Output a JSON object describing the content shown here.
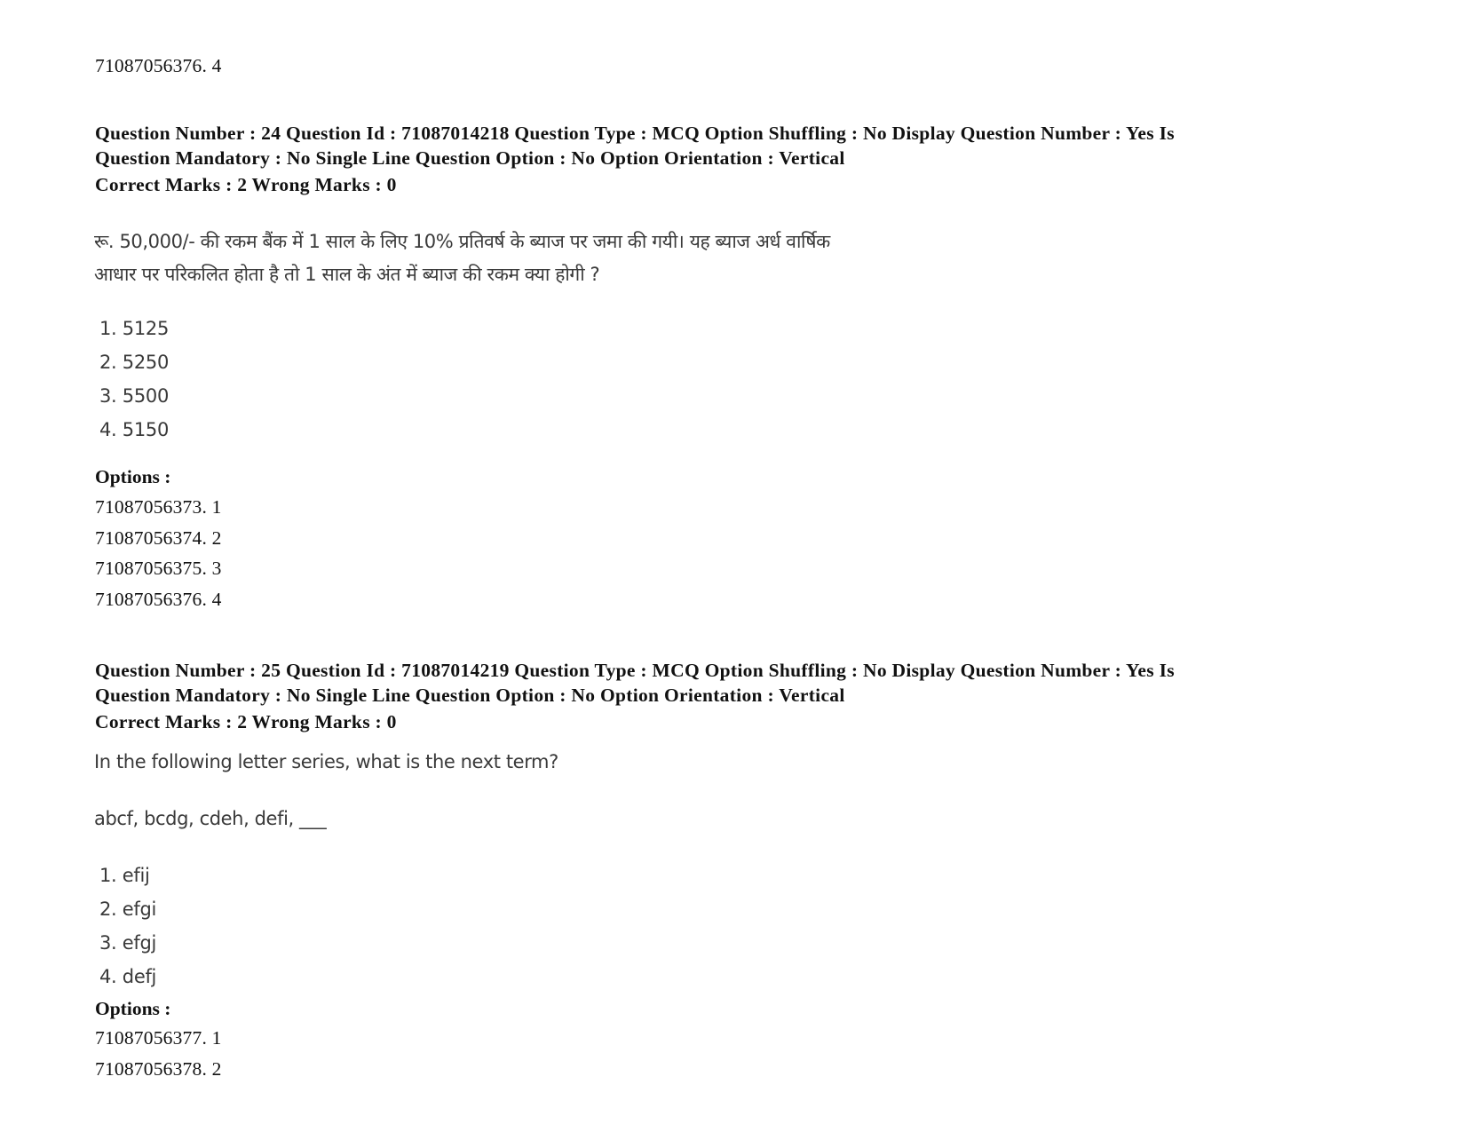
{
  "previous_tail": {
    "option_id_row": "71087056376. 4"
  },
  "questions": [
    {
      "meta_line1": "Question Number : 24 Question Id : 71087014218 Question Type : MCQ Option Shuffling : No Display Question Number : Yes Is",
      "meta_line2": "Question Mandatory : No Single Line Question Option : No Option Orientation : Vertical",
      "marks": "Correct Marks : 2 Wrong Marks : 0",
      "text_lines": [
        "रू. 50,000/- की रकम बैंक में 1 साल के लिए 10% प्रतिवर्ष के ब्याज पर जमा की गयी। यह ब्याज अर्ध वार्षिक",
        "आधार पर परिकलित होता है तो 1 साल के अंत में ब्याज की रकम क्या होगी ?"
      ],
      "choices": [
        "1. 5125",
        "2. 5250",
        "3. 5500",
        "4. 5150"
      ],
      "options_label": "Options :",
      "option_ids": [
        "71087056373. 1",
        "71087056374. 2",
        "71087056375. 3",
        "71087056376. 4"
      ]
    },
    {
      "meta_line1": "Question Number : 25 Question Id : 71087014219 Question Type : MCQ Option Shuffling : No Display Question Number : Yes Is",
      "meta_line2": "Question Mandatory : No Single Line Question Option : No Option Orientation : Vertical",
      "marks": "Correct Marks : 2 Wrong Marks : 0",
      "text_lines": [
        "In the following letter series, what is the next term?",
        "abcf, bcdg, cdeh, defi, ___"
      ],
      "choices": [
        "1. efij",
        "2. efgi",
        "3. efgj",
        "4. defj"
      ],
      "options_label": "Options :",
      "option_ids": [
        "71087056377. 1",
        "71087056378. 2"
      ]
    }
  ]
}
